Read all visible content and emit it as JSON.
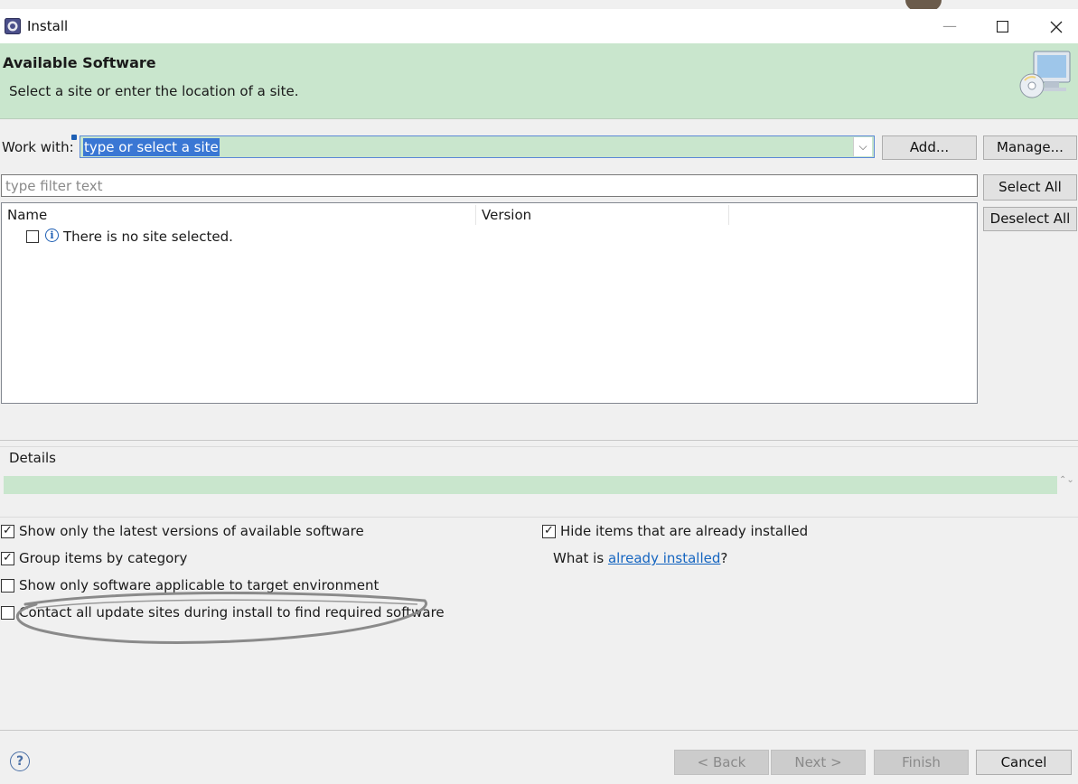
{
  "window": {
    "title": "Install",
    "minimize_glyph": "—",
    "maximize_glyph": "☐",
    "close_glyph": "✕"
  },
  "header": {
    "title": "Available Software",
    "description": "Select a site or enter the location of a site."
  },
  "work_with": {
    "label": "Work with:",
    "value": "type or select a site",
    "dropdown_glyph": "⌵",
    "add_label": "Add...",
    "manage_label": "Manage..."
  },
  "filter": {
    "placeholder": "type filter text",
    "select_all_label": "Select All",
    "deselect_all_label": "Deselect All"
  },
  "table": {
    "columns": [
      "Name",
      "Version"
    ],
    "rows": [
      {
        "name": "There is no site selected.",
        "info_glyph": "i"
      }
    ]
  },
  "details": {
    "label": "Details",
    "scroll_glyph": "⌃⌄"
  },
  "options": {
    "show_latest": {
      "label": "Show only the latest versions of available software",
      "checked": true
    },
    "group_by_category": {
      "label": "Group items by category",
      "checked": true
    },
    "target_env": {
      "label": "Show only software applicable to target environment",
      "checked": false
    },
    "contact_sites": {
      "label": "Contact all update sites during install to find required software",
      "checked": false
    },
    "hide_installed": {
      "label": "Hide items that are already installed",
      "checked": true
    },
    "what_is_prefix": "What is ",
    "already_installed_link": "already installed",
    "what_is_suffix": "?"
  },
  "footer": {
    "help_glyph": "?",
    "back_label": "< Back",
    "next_label": "Next >",
    "finish_label": "Finish",
    "cancel_label": "Cancel"
  },
  "colors": {
    "header_bg": "#c9e6cd",
    "selection": "#3a77d4",
    "link": "#1565c0"
  }
}
